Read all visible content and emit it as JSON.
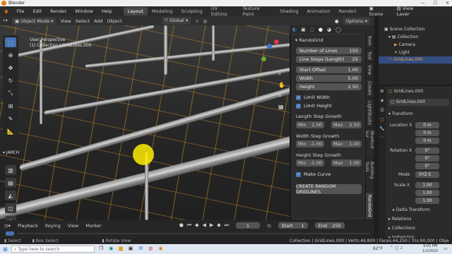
{
  "window": {
    "title": "Blender"
  },
  "menu": [
    "File",
    "Edit",
    "Render",
    "Window",
    "Help"
  ],
  "workspaces": [
    "Layout",
    "Modeling",
    "Sculpting",
    "UV Editing",
    "Texture Paint",
    "Shading",
    "Animation",
    "Renderi"
  ],
  "scene": {
    "label": "Scene",
    "view_layer": "View Layer"
  },
  "viewport_header": {
    "mode": "Object Mode",
    "items": [
      "View",
      "Select",
      "Add",
      "Object"
    ],
    "transform": "Global",
    "options": "Options"
  },
  "viewport": {
    "overlay_line1": "User Perspective",
    "overlay_line2": "(1) Collection | GridLines.000"
  },
  "jarch": "JARCH",
  "panel": {
    "title": "RandoGrid",
    "fields": [
      {
        "label": "Number of Lines",
        "value": "150"
      },
      {
        "label": "Line Steps (Length)",
        "value": "25"
      },
      {
        "label": "Start Offset",
        "value": "1.00"
      },
      {
        "label": "Width",
        "value": "5.00"
      },
      {
        "label": "Height",
        "value": "2.50"
      }
    ],
    "limit_width": "Limit Width",
    "limit_height": "Limit Height",
    "groups": [
      {
        "title": "Length Step Growth",
        "min_label": "Min",
        "min": "1.00",
        "max_label": "Max",
        "max": "2.50"
      },
      {
        "title": "Width Step Growth",
        "min_label": "Min",
        "min": "-1.00",
        "max_label": "Max",
        "max": "1.00"
      },
      {
        "title": "Height Step Growth",
        "min_label": "Min",
        "min": "-1.00",
        "max_label": "Max",
        "max": "1.00"
      }
    ],
    "make_curve": "Make Curve",
    "button": "CREATE RANDOM GRIDLINES"
  },
  "side_tabs": [
    "Item",
    "Tool",
    "View",
    "Create",
    "LightStudio",
    "Shortcut Vur",
    "Building Tools",
    "RandoGrid"
  ],
  "outliner": {
    "scene_collection": "Scene Collection",
    "items": [
      "Collection",
      "Camera",
      "Light",
      "GridLines.000"
    ]
  },
  "properties": {
    "object": "GridLines.000",
    "data": "GridLines.000",
    "transform": "Transform",
    "location": {
      "label": "Location X",
      "x": "0 m",
      "y": "0 m",
      "z": "0 m"
    },
    "rotation": {
      "label": "Rotation X",
      "x": "0°",
      "y": "0°",
      "z": "0°"
    },
    "mode_label": "Mode",
    "mode": "XYZ E",
    "scale": {
      "label": "Scale X",
      "x": "1.00",
      "y": "1.00",
      "z": "1.00"
    },
    "delta": "Delta Transform",
    "relations": "Relations",
    "collections": "Collections",
    "instancing": "Instancing"
  },
  "timeline": {
    "menus": [
      "Playback",
      "Keying",
      "View",
      "Marker"
    ],
    "frame": "1",
    "start_label": "Start",
    "start": "1",
    "end_label": "End",
    "end": "250"
  },
  "status": {
    "select": "Select",
    "box_select": "Box Select",
    "rotate": "Rotate View",
    "info": "Collection | GridLines.000 | Verts:46,800 | Faces:44,250 | Tris:90,000 | Objects:1/3 | ..."
  },
  "taskbar": {
    "search": "Type here to search",
    "temp": "62°F",
    "time": "9:01 PM",
    "date": "1/2/2022"
  }
}
